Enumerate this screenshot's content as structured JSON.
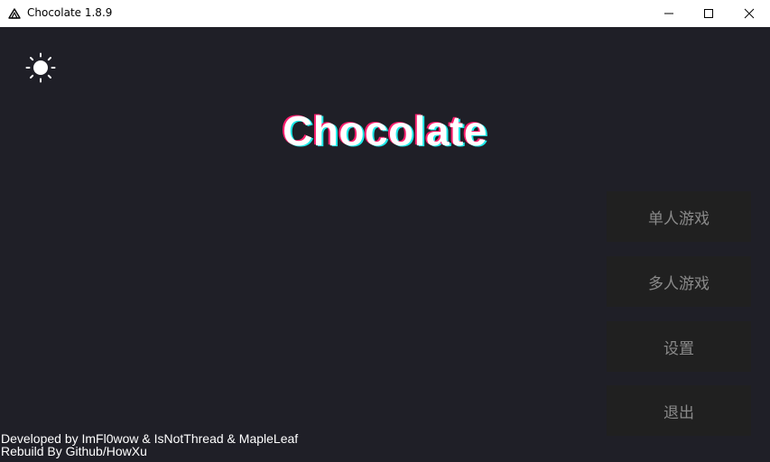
{
  "window": {
    "title": "Chocolate 1.8.9",
    "icon": "triangle-logo-icon",
    "controls": [
      "minimize-icon",
      "maximize-icon",
      "close-icon"
    ]
  },
  "theme_toggle": {
    "icon": "sun-icon"
  },
  "logo": {
    "text": "Chocolate",
    "colors": {
      "text": "#ffffff",
      "shadow_left": "#ff1e6e",
      "shadow_right": "#1ee8e8"
    }
  },
  "menu": {
    "singleplayer_label": "单人游戏",
    "multiplayer_label": "多人游戏",
    "settings_label": "设置",
    "quit_label": "退出"
  },
  "credits": {
    "line1": "Developed by ImFl0wow & IsNotThread & MapleLeaf",
    "line2": "Rebuild By Github/HowXu"
  },
  "colors": {
    "background": "#1f1f27",
    "button_bg": "#202020",
    "button_text": "#8a8a8a"
  }
}
